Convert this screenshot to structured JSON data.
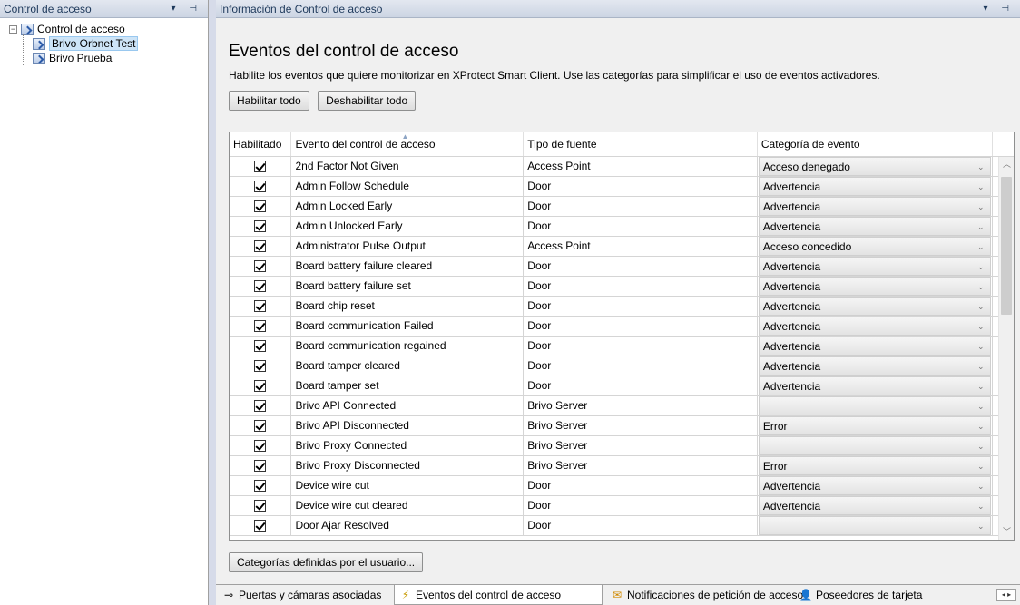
{
  "left_pane": {
    "header_title": "Control de acceso",
    "header_controls": "▾ ⊣",
    "tree": {
      "root_label": "Control de acceso",
      "children": [
        "Brivo Orbnet Test",
        "Brivo Prueba"
      ]
    }
  },
  "right_pane": {
    "header_title": "Información de Control de acceso",
    "header_controls": "▾ ⊣",
    "title": "Eventos del control de acceso",
    "description": "Habilite los eventos que quiere monitorizar en XProtect Smart Client. Use las categorías para simplificar el uso de eventos activadores.",
    "enable_all_label": "Habilitar todo",
    "disable_all_label": "Deshabilitar todo",
    "user_categories_label": "Categorías definidas por el usuario...",
    "columns": [
      "Habilitado",
      "Evento del control de acceso",
      "Tipo de fuente",
      "Categoría de evento"
    ],
    "rows": [
      {
        "enabled": true,
        "event": "2nd Factor Not Given",
        "source": "Access Point",
        "category": "Acceso denegado"
      },
      {
        "enabled": true,
        "event": "Admin Follow Schedule",
        "source": "Door",
        "category": "Advertencia"
      },
      {
        "enabled": true,
        "event": "Admin Locked Early",
        "source": "Door",
        "category": "Advertencia"
      },
      {
        "enabled": true,
        "event": "Admin Unlocked Early",
        "source": "Door",
        "category": "Advertencia"
      },
      {
        "enabled": true,
        "event": "Administrator Pulse Output",
        "source": "Access Point",
        "category": "Acceso concedido"
      },
      {
        "enabled": true,
        "event": "Board battery failure cleared",
        "source": "Door",
        "category": "Advertencia"
      },
      {
        "enabled": true,
        "event": "Board battery failure set",
        "source": "Door",
        "category": "Advertencia"
      },
      {
        "enabled": true,
        "event": "Board chip reset",
        "source": "Door",
        "category": "Advertencia"
      },
      {
        "enabled": true,
        "event": "Board communication Failed",
        "source": "Door",
        "category": "Advertencia"
      },
      {
        "enabled": true,
        "event": "Board communication regained",
        "source": "Door",
        "category": "Advertencia"
      },
      {
        "enabled": true,
        "event": "Board tamper cleared",
        "source": "Door",
        "category": "Advertencia"
      },
      {
        "enabled": true,
        "event": "Board tamper set",
        "source": "Door",
        "category": "Advertencia"
      },
      {
        "enabled": true,
        "event": "Brivo API Connected",
        "source": "Brivo Server",
        "category": ""
      },
      {
        "enabled": true,
        "event": "Brivo API Disconnected",
        "source": "Brivo Server",
        "category": "Error"
      },
      {
        "enabled": true,
        "event": "Brivo Proxy Connected",
        "source": "Brivo Server",
        "category": ""
      },
      {
        "enabled": true,
        "event": "Brivo Proxy Disconnected",
        "source": "Brivo Server",
        "category": "Error"
      },
      {
        "enabled": true,
        "event": "Device wire cut",
        "source": "Door",
        "category": "Advertencia"
      },
      {
        "enabled": true,
        "event": "Device wire cut cleared",
        "source": "Door",
        "category": "Advertencia"
      },
      {
        "enabled": true,
        "event": "Door Ajar Resolved",
        "source": "Door",
        "category": ""
      }
    ],
    "tabs": [
      {
        "label": "Puertas y cámaras asociadas",
        "icon": "camera-icon",
        "glyph": "⊸"
      },
      {
        "label": "Eventos del control de acceso",
        "icon": "event-icon",
        "glyph": "⚡"
      },
      {
        "label": "Notificaciones de petición de acceso",
        "icon": "notification-icon",
        "glyph": "✉"
      },
      {
        "label": "Poseedores de tarjeta",
        "icon": "person-icon",
        "glyph": "👤"
      }
    ],
    "active_tab": "Eventos del control de acceso"
  }
}
